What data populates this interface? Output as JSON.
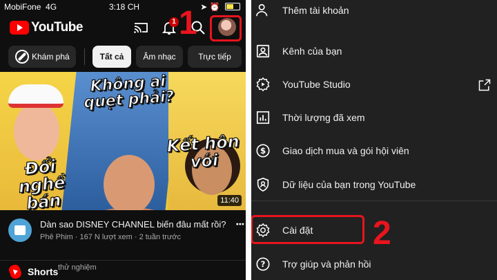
{
  "status_bar": {
    "carrier": "MobiFone",
    "network": "4G",
    "time": "3:18 CH",
    "battery": "battery-icon"
  },
  "header": {
    "logo_text": "YouTube",
    "notification_count": "1",
    "step1_label": "1"
  },
  "chips": {
    "explore": "Khám phá",
    "items": [
      "Tất cả",
      "Âm nhạc",
      "Trực tiếp"
    ]
  },
  "thumbnail": {
    "caption_top": "Không ai quẹt phải?",
    "caption_left": "Đổi nghề bán kem?",
    "caption_right": "Kết hôn với",
    "duration": "11:40"
  },
  "video": {
    "title": "Dàn sao DISNEY CHANNEL biến đâu mất rồi?",
    "meta": "Phê Phim · 167 N lượt xem · 2 tuần trước"
  },
  "shorts": {
    "label": "Shorts",
    "sublabel": "thử nghiệm"
  },
  "menu": {
    "add_account": "Thêm tài khoản",
    "your_channel": "Kênh của bạn",
    "studio": "YouTube Studio",
    "watch_time": "Thời lượng đã xem",
    "purchases": "Giao dịch mua và gói hội viên",
    "your_data": "Dữ liệu của bạn trong YouTube",
    "settings": "Cài đặt",
    "help": "Trợ giúp và phản hồi",
    "step2_label": "2"
  },
  "colors": {
    "accent_red": "#e8141e",
    "youtube_red": "#ff0000",
    "dark_bg": "#0f0f0f",
    "menu_bg": "#212121"
  }
}
